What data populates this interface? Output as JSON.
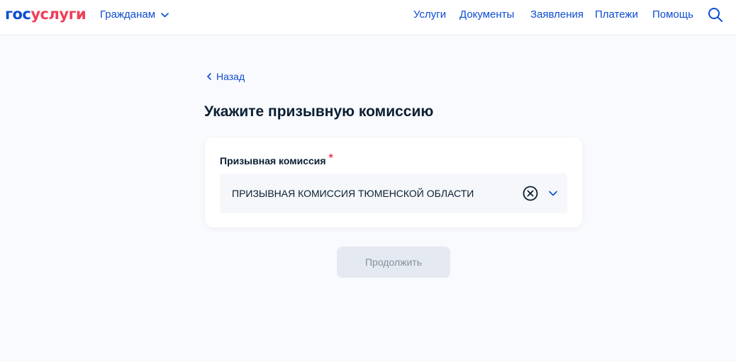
{
  "header": {
    "logo_part1": "гос",
    "logo_part2": "услуги",
    "citizens_label": "Гражданам",
    "nav": [
      {
        "label": "Услуги"
      },
      {
        "label": "Документы"
      },
      {
        "label": "Заявления"
      },
      {
        "label": "Платежи"
      },
      {
        "label": "Помощь"
      }
    ],
    "search_icon": "search-icon"
  },
  "main": {
    "back_label": "Назад",
    "title": "Укажите призывную комиссию",
    "field": {
      "label": "Призывная комиссия",
      "required_mark": "*",
      "value": "ПРИЗЫВНАЯ КОМИССИЯ ТЮМЕНСКОЙ ОБЛАСТИ"
    },
    "continue_label": "Продолжить"
  },
  "colors": {
    "brand_blue": "#0d4cd3",
    "brand_red": "#ee3f58",
    "text": "#0b1f33",
    "page_bg": "#f9fafd",
    "disabled_button_bg": "#e4e9f2",
    "disabled_button_text": "#86909c"
  }
}
